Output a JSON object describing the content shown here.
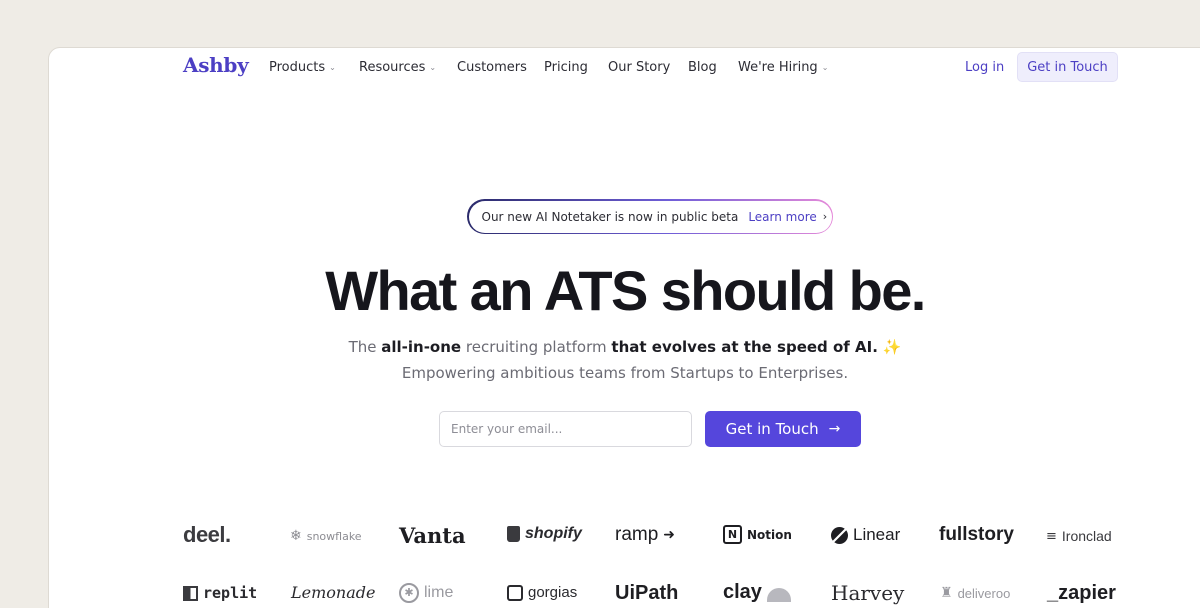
{
  "brand": {
    "name": "Ashby"
  },
  "nav": {
    "items": [
      {
        "label": "Products",
        "dropdown": true
      },
      {
        "label": "Resources",
        "dropdown": true
      },
      {
        "label": "Customers",
        "dropdown": false
      },
      {
        "label": "Pricing",
        "dropdown": false
      },
      {
        "label": "Our Story",
        "dropdown": false
      },
      {
        "label": "Blog",
        "dropdown": false
      },
      {
        "label": "We're Hiring",
        "dropdown": true
      }
    ],
    "login": "Log in",
    "cta": "Get in Touch"
  },
  "announcement": {
    "text": "Our new AI Notetaker is now in public beta",
    "link": "Learn more"
  },
  "hero": {
    "headline": "What an ATS should be.",
    "sub_the": "The",
    "sub_bold1": "all-in-one",
    "sub_mid": "recruiting platform",
    "sub_bold2": "that evolves at the speed of AI.",
    "sub_line2": "Empowering ambitious teams from Startups to Enterprises.",
    "email_placeholder": "Enter your email...",
    "cta": "Get in Touch"
  },
  "logos": {
    "row1": [
      "deel.",
      "snowflake",
      "Vanta",
      "shopify",
      "ramp",
      "Notion",
      "Linear",
      "fullstory",
      "Ironclad"
    ],
    "row2": [
      "replit",
      "Lemonade",
      "lime",
      "gorgias",
      "UiPath",
      "clay",
      "Harvey",
      "deliveroo",
      "_zapier"
    ]
  },
  "colors": {
    "accent": "#5546dc",
    "brand": "#4c3fc4",
    "background": "#efece6"
  }
}
